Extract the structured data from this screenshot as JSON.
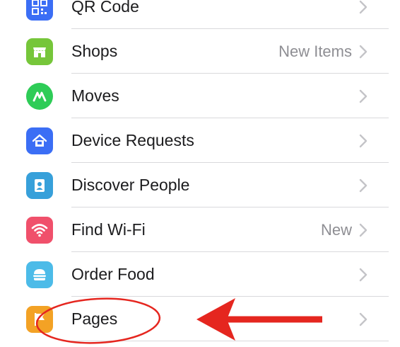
{
  "menu": {
    "items": [
      {
        "label": "QR Code",
        "value": "",
        "icon": "qr-code-icon",
        "color": "#3b6ef5"
      },
      {
        "label": "Shops",
        "value": "New Items",
        "icon": "shop-storefront-icon",
        "color": "#76c63a"
      },
      {
        "label": "Moves",
        "value": "",
        "icon": "moves-icon",
        "color": "#2ecc57"
      },
      {
        "label": "Device Requests",
        "value": "",
        "icon": "device-requests-icon",
        "color": "#3b6ef5"
      },
      {
        "label": "Discover People",
        "value": "",
        "icon": "discover-people-icon",
        "color": "#37a0da"
      },
      {
        "label": "Find Wi-Fi",
        "value": "New",
        "icon": "wifi-icon",
        "color": "#f0506b"
      },
      {
        "label": "Order Food",
        "value": "",
        "icon": "burger-icon",
        "color": "#4cbbe8"
      },
      {
        "label": "Pages",
        "value": "",
        "icon": "pages-flag-icon",
        "color": "#f3a225"
      }
    ],
    "chevron": "chevron-right-icon",
    "separator_color": "#d9d9dc"
  },
  "annotation": {
    "color": "#e5261f",
    "shapes": [
      "ellipse-highlight",
      "arrow-left"
    ]
  }
}
